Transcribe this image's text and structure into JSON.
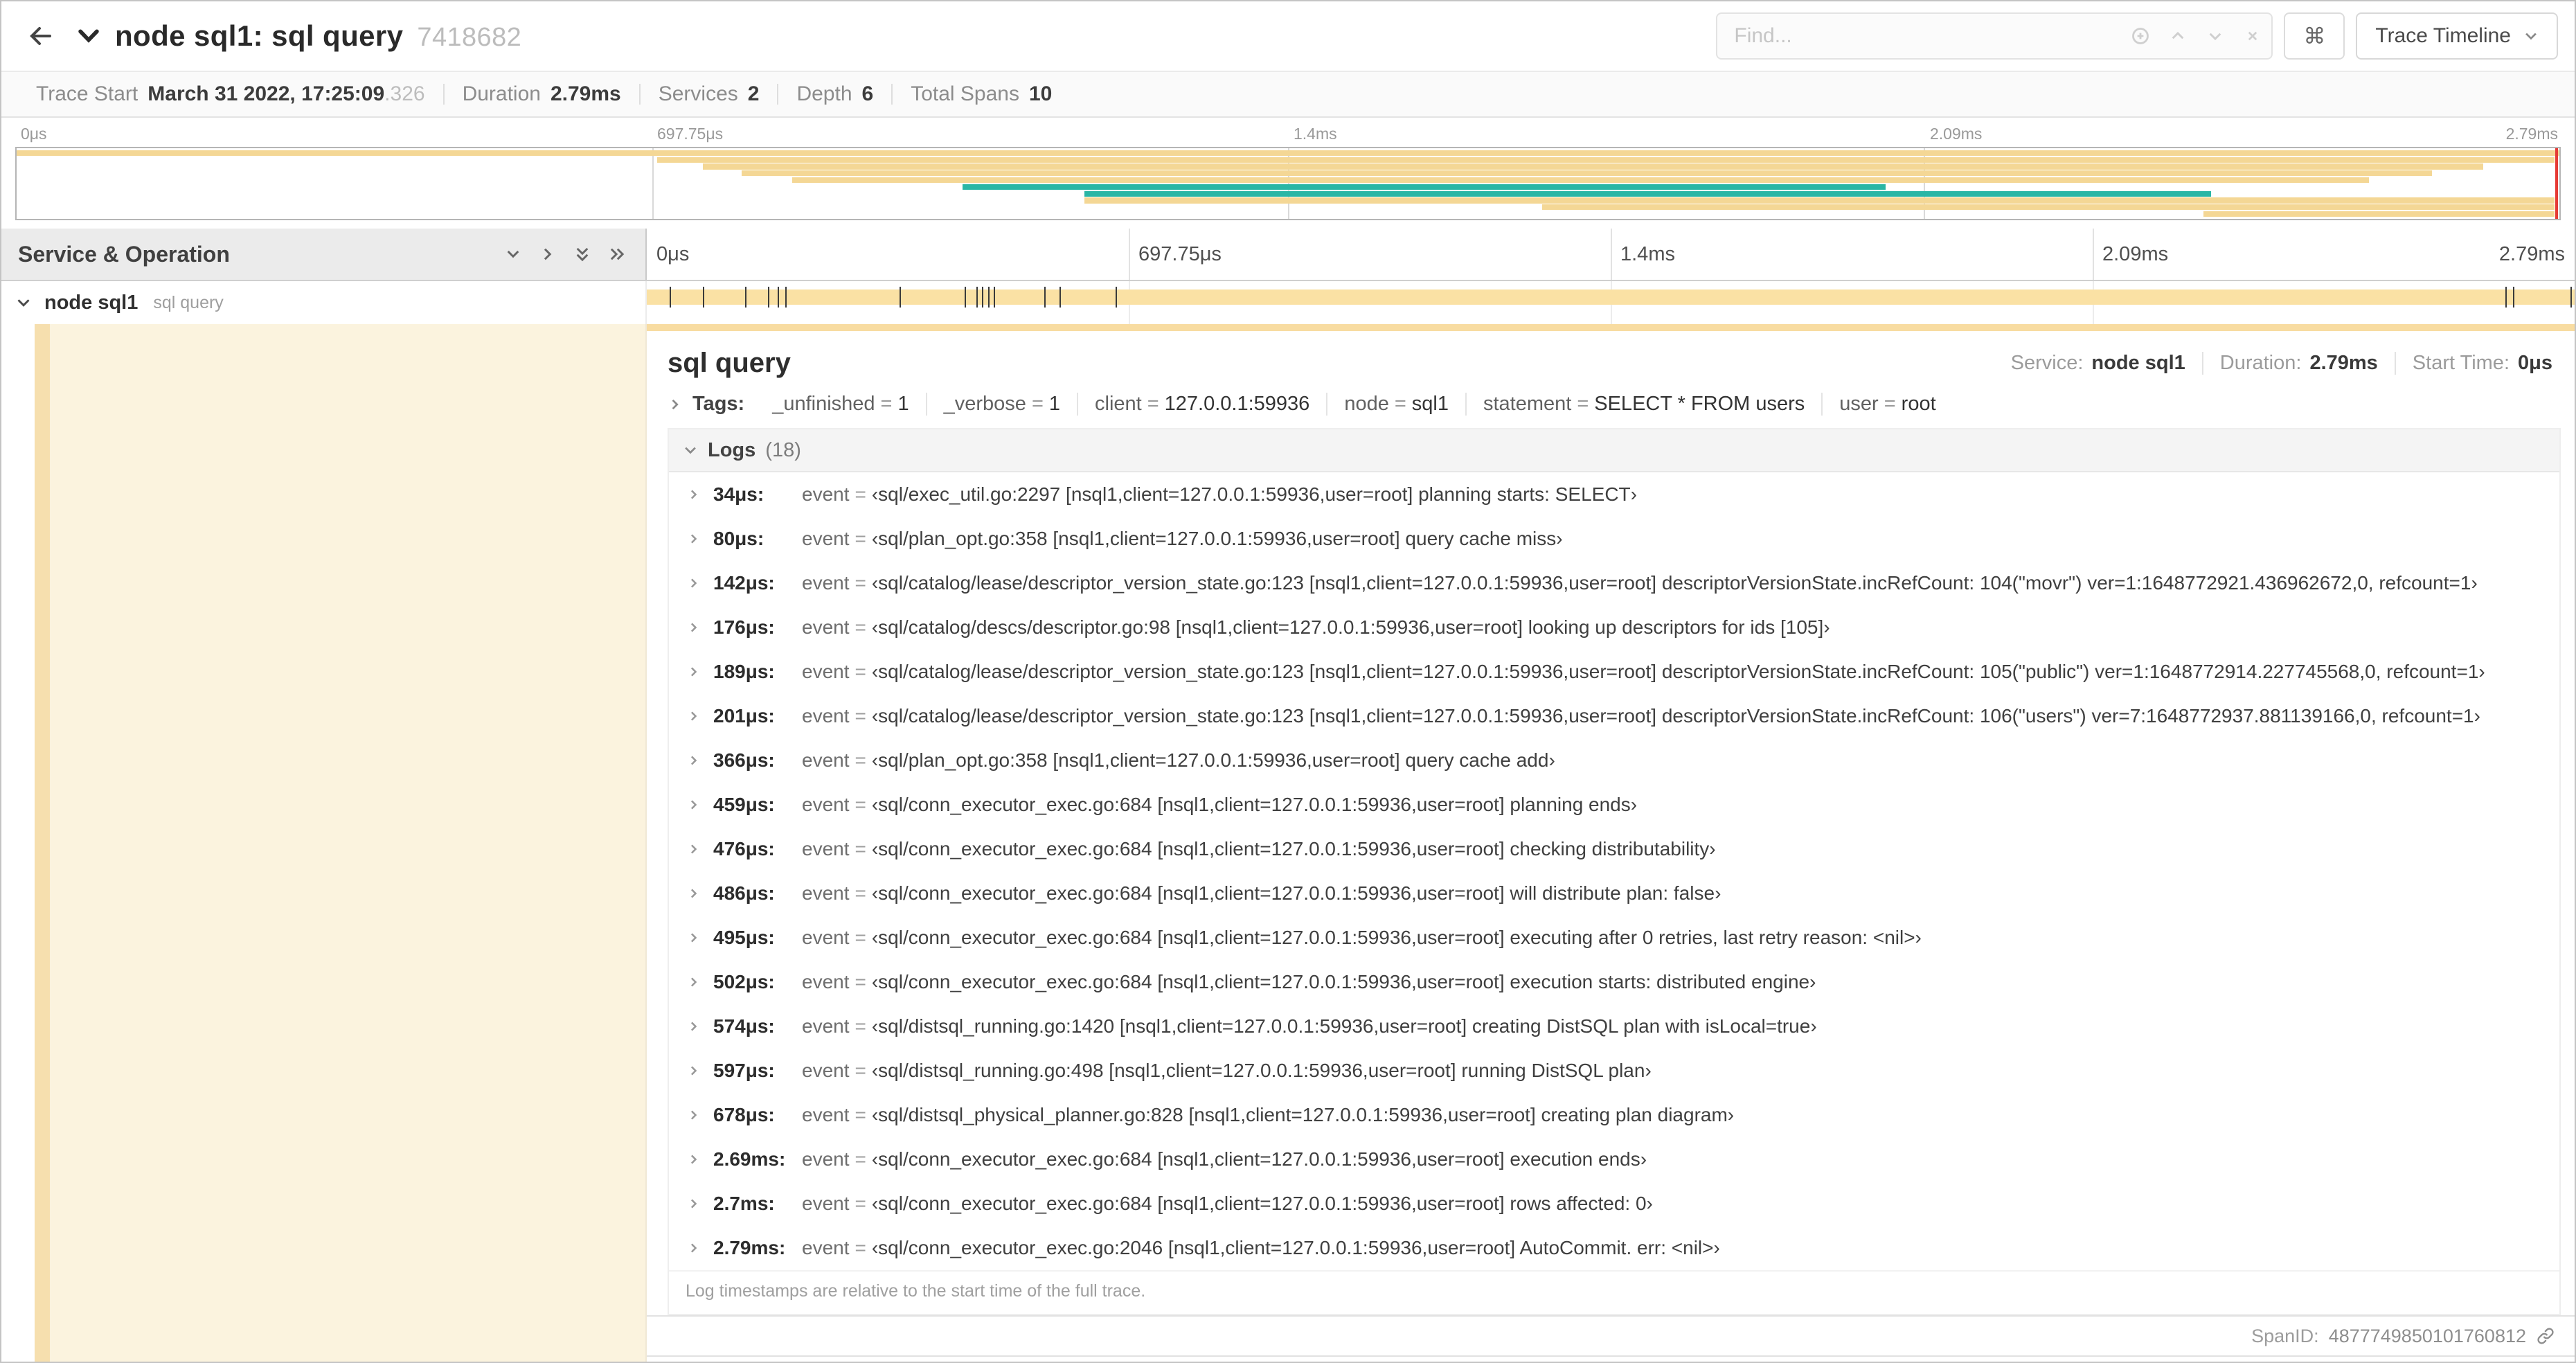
{
  "colors": {
    "span_bar": "#FAE1A4",
    "minimap_tan": "#F4D795",
    "minimap_teal": "#2AB6A5",
    "detail_accent": "#F8DCA1",
    "viewport_handle": "#E63B35"
  },
  "header": {
    "title": "node sql1: sql query",
    "trace_id": "7418682",
    "find_placeholder": "Find...",
    "view_button": "Trace Timeline",
    "shortcuts_symbol": "⌘"
  },
  "summary": {
    "items": [
      {
        "label": "Trace Start",
        "value": "March 31 2022, 17:25:09",
        "suffix": ".326"
      },
      {
        "label": "Duration",
        "value": "2.79ms",
        "suffix": ""
      },
      {
        "label": "Services",
        "value": "2",
        "suffix": ""
      },
      {
        "label": "Depth",
        "value": "6",
        "suffix": ""
      },
      {
        "label": "Total Spans",
        "value": "10",
        "suffix": ""
      }
    ]
  },
  "ruler": {
    "ticks": [
      {
        "label": "0μs",
        "left": "0%"
      },
      {
        "label": "697.75μs",
        "left": "25%"
      },
      {
        "label": "1.4ms",
        "left": "50%"
      },
      {
        "label": "2.09ms",
        "left": "75%"
      },
      {
        "label": "2.79ms",
        "left": "100%"
      }
    ]
  },
  "minimap": {
    "spans": [
      {
        "left": "0%",
        "width": "100%",
        "color": "#F4D795"
      },
      {
        "left": "25.2%",
        "width": "74.6%",
        "color": "#F4D795"
      },
      {
        "left": "27%",
        "width": "70%",
        "color": "#F4D795"
      },
      {
        "left": "28.5%",
        "width": "66.5%",
        "color": "#F4D795"
      },
      {
        "left": "30.5%",
        "width": "62%",
        "color": "#F4D795"
      },
      {
        "left": "37.2%",
        "width": "36.3%",
        "color": "#2AB6A5"
      },
      {
        "left": "42%",
        "width": "44.3%",
        "color": "#2AB6A5"
      },
      {
        "left": "42%",
        "width": "57.8%",
        "color": "#F4D795"
      },
      {
        "left": "60%",
        "width": "39.8%",
        "color": "#F4D795"
      },
      {
        "left": "86%",
        "width": "13.8%",
        "color": "#F4D795"
      }
    ]
  },
  "timeline": {
    "left_header": "Service & Operation",
    "row": {
      "service": "node sql1",
      "operation": "sql query"
    },
    "markers": [
      "1.2%",
      "2.9%",
      "5.1%",
      "6.3%",
      "6.8%",
      "7.2%",
      "13.1%",
      "16.5%",
      "17.1%",
      "17.4%",
      "17.7%",
      "18%",
      "20.6%",
      "21.4%",
      "24.3%",
      "96.4%",
      "96.8%",
      "99.8%"
    ]
  },
  "detail": {
    "title": "sql query",
    "meta": [
      {
        "label": "Service:",
        "value": "node sql1"
      },
      {
        "label": "Duration:",
        "value": "2.79ms"
      },
      {
        "label": "Start Time:",
        "value": "0μs"
      }
    ],
    "tags": {
      "label": "Tags:",
      "items": [
        {
          "key": "_unfinished",
          "value": "1"
        },
        {
          "key": "_verbose",
          "value": "1"
        },
        {
          "key": "client",
          "value": "127.0.0.1:59936"
        },
        {
          "key": "node",
          "value": "sql1"
        },
        {
          "key": "statement",
          "value": "SELECT * FROM users"
        },
        {
          "key": "user",
          "value": "root"
        }
      ]
    },
    "logs": {
      "label": "Logs",
      "count": "(18)",
      "entries": [
        {
          "time": "34μs:",
          "key": "event",
          "value": "‹sql/exec_util.go:2297 [nsql1,client=127.0.0.1:59936,user=root] planning starts: SELECT›"
        },
        {
          "time": "80μs:",
          "key": "event",
          "value": "‹sql/plan_opt.go:358 [nsql1,client=127.0.0.1:59936,user=root] query cache miss›"
        },
        {
          "time": "142μs:",
          "key": "event",
          "value": "‹sql/catalog/lease/descriptor_version_state.go:123 [nsql1,client=127.0.0.1:59936,user=root] descriptorVersionState.incRefCount: 104(\"movr\") ver=1:1648772921.436962672,0, refcount=1›"
        },
        {
          "time": "176μs:",
          "key": "event",
          "value": "‹sql/catalog/descs/descriptor.go:98 [nsql1,client=127.0.0.1:59936,user=root] looking up descriptors for ids [105]›"
        },
        {
          "time": "189μs:",
          "key": "event",
          "value": "‹sql/catalog/lease/descriptor_version_state.go:123 [nsql1,client=127.0.0.1:59936,user=root] descriptorVersionState.incRefCount: 105(\"public\") ver=1:1648772914.227745568,0, refcount=1›"
        },
        {
          "time": "201μs:",
          "key": "event",
          "value": "‹sql/catalog/lease/descriptor_version_state.go:123 [nsql1,client=127.0.0.1:59936,user=root] descriptorVersionState.incRefCount: 106(\"users\") ver=7:1648772937.881139166,0, refcount=1›"
        },
        {
          "time": "366μs:",
          "key": "event",
          "value": "‹sql/plan_opt.go:358 [nsql1,client=127.0.0.1:59936,user=root] query cache add›"
        },
        {
          "time": "459μs:",
          "key": "event",
          "value": "‹sql/conn_executor_exec.go:684 [nsql1,client=127.0.0.1:59936,user=root] planning ends›"
        },
        {
          "time": "476μs:",
          "key": "event",
          "value": "‹sql/conn_executor_exec.go:684 [nsql1,client=127.0.0.1:59936,user=root] checking distributability›"
        },
        {
          "time": "486μs:",
          "key": "event",
          "value": "‹sql/conn_executor_exec.go:684 [nsql1,client=127.0.0.1:59936,user=root] will distribute plan: false›"
        },
        {
          "time": "495μs:",
          "key": "event",
          "value": "‹sql/conn_executor_exec.go:684 [nsql1,client=127.0.0.1:59936,user=root] executing after 0 retries, last retry reason: <nil>›"
        },
        {
          "time": "502μs:",
          "key": "event",
          "value": "‹sql/conn_executor_exec.go:684 [nsql1,client=127.0.0.1:59936,user=root] execution starts: distributed engine›"
        },
        {
          "time": "574μs:",
          "key": "event",
          "value": "‹sql/distsql_running.go:1420 [nsql1,client=127.0.0.1:59936,user=root] creating DistSQL plan with isLocal=true›"
        },
        {
          "time": "597μs:",
          "key": "event",
          "value": "‹sql/distsql_running.go:498 [nsql1,client=127.0.0.1:59936,user=root] running DistSQL plan›"
        },
        {
          "time": "678μs:",
          "key": "event",
          "value": "‹sql/distsql_physical_planner.go:828 [nsql1,client=127.0.0.1:59936,user=root] creating plan diagram›"
        },
        {
          "time": "2.69ms:",
          "key": "event",
          "value": "‹sql/conn_executor_exec.go:684 [nsql1,client=127.0.0.1:59936,user=root] execution ends›"
        },
        {
          "time": "2.7ms:",
          "key": "event",
          "value": "‹sql/conn_executor_exec.go:684 [nsql1,client=127.0.0.1:59936,user=root] rows affected: 0›"
        },
        {
          "time": "2.79ms:",
          "key": "event",
          "value": "‹sql/conn_executor_exec.go:2046 [nsql1,client=127.0.0.1:59936,user=root] AutoCommit. err: <nil>›"
        }
      ],
      "footnote": "Log timestamps are relative to the start time of the full trace."
    },
    "span_id_label": "SpanID:",
    "span_id": "4877749850101760812"
  }
}
